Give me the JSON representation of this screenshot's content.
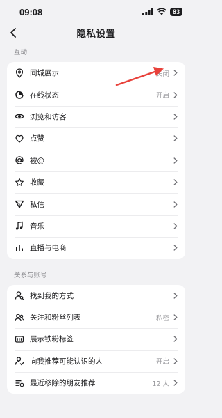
{
  "status_bar": {
    "time": "09:08",
    "battery": "83"
  },
  "header": {
    "title": "隐私设置"
  },
  "sections": [
    {
      "title": "互动",
      "items": [
        {
          "label": "同城展示",
          "value": "关闭",
          "icon": "location-pin-icon"
        },
        {
          "label": "在线状态",
          "value": "开启",
          "icon": "online-status-icon"
        },
        {
          "label": "浏览和访客",
          "value": "",
          "icon": "eye-icon"
        },
        {
          "label": "点赞",
          "value": "",
          "icon": "heart-icon"
        },
        {
          "label": "被@",
          "value": "",
          "icon": "at-icon"
        },
        {
          "label": "收藏",
          "value": "",
          "icon": "star-icon"
        },
        {
          "label": "私信",
          "value": "",
          "icon": "send-icon"
        },
        {
          "label": "音乐",
          "value": "",
          "icon": "music-icon"
        },
        {
          "label": "直播与电商",
          "value": "",
          "icon": "live-bars-icon"
        }
      ]
    },
    {
      "title": "关系与账号",
      "items": [
        {
          "label": "找到我的方式",
          "value": "",
          "icon": "search-user-icon"
        },
        {
          "label": "关注和粉丝列表",
          "value": "私密",
          "icon": "users-icon"
        },
        {
          "label": "展示铁粉标签",
          "value": "",
          "icon": "badge-icon"
        },
        {
          "label": "向我推荐可能认识的人",
          "value": "开启",
          "icon": "recommend-user-icon"
        },
        {
          "label": "最近移除的朋友推荐",
          "value": "12 人",
          "icon": "removed-list-icon"
        }
      ]
    }
  ],
  "colors": {
    "annotation_arrow": "#e8413a",
    "text_primary": "#1c1c1e",
    "text_secondary": "#9a9a9e"
  }
}
